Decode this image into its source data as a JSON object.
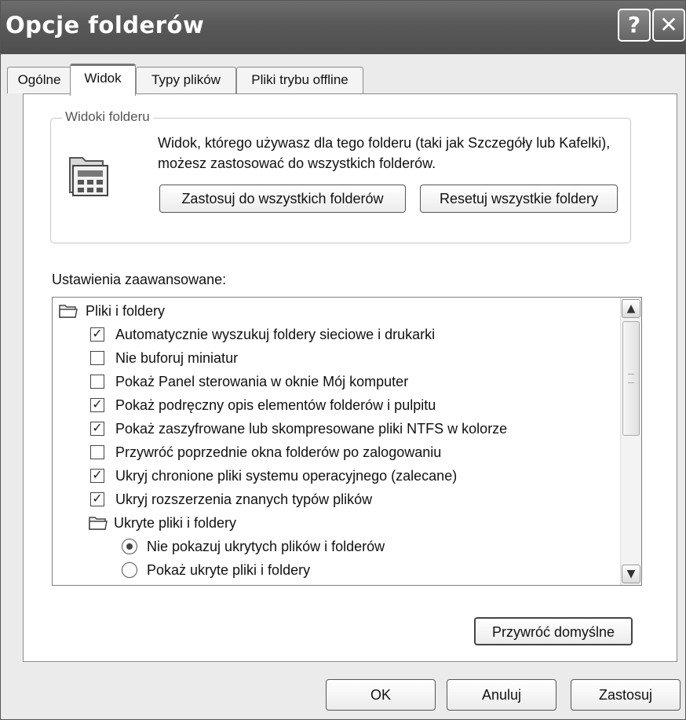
{
  "window": {
    "title": "Opcje folderów",
    "help_glyph": "?",
    "close_glyph": "✕"
  },
  "tabs": [
    {
      "label": "Ogólne"
    },
    {
      "label": "Widok",
      "active": true
    },
    {
      "label": "Typy plików"
    },
    {
      "label": "Pliki trybu offline"
    }
  ],
  "folder_views": {
    "legend": "Widoki folderu",
    "description": "Widok, którego używasz dla tego folderu (taki jak Szczegóły lub Kafelki), możesz zastosować do wszystkich folderów.",
    "apply_all_label": "Zastosuj do wszystkich folderów",
    "reset_all_label": "Resetuj wszystkie foldery"
  },
  "advanced": {
    "label": "Ustawienia zaawansowane:",
    "items": [
      {
        "type": "folder",
        "level": 0,
        "label": "Pliki i foldery"
      },
      {
        "type": "checkbox",
        "level": 1,
        "checked": true,
        "label": "Automatycznie wyszukuj foldery sieciowe i drukarki"
      },
      {
        "type": "checkbox",
        "level": 1,
        "checked": false,
        "label": "Nie buforuj miniatur"
      },
      {
        "type": "checkbox",
        "level": 1,
        "checked": false,
        "label": "Pokaż Panel sterowania w oknie Mój komputer"
      },
      {
        "type": "checkbox",
        "level": 1,
        "checked": true,
        "label": "Pokaż podręczny opis elementów folderów i pulpitu"
      },
      {
        "type": "checkbox",
        "level": 1,
        "checked": true,
        "label": "Pokaż zaszyfrowane lub skompresowane pliki NTFS w kolorze"
      },
      {
        "type": "checkbox",
        "level": 1,
        "checked": false,
        "label": "Przywróć poprzednie okna folderów po zalogowaniu"
      },
      {
        "type": "checkbox",
        "level": 1,
        "checked": true,
        "label": "Ukryj chronione pliki systemu operacyjnego (zalecane)"
      },
      {
        "type": "checkbox",
        "level": 1,
        "checked": true,
        "label": "Ukryj rozszerzenia znanych typów plików"
      },
      {
        "type": "folder",
        "level": 1,
        "label": "Ukryte pliki i foldery"
      },
      {
        "type": "radio",
        "level": 2,
        "checked": true,
        "label": "Nie pokazuj ukrytych plików i folderów"
      },
      {
        "type": "radio",
        "level": 2,
        "checked": false,
        "label": "Pokaż ukryte pliki i foldery"
      }
    ],
    "restore_defaults_label": "Przywróć domyślne"
  },
  "footer": {
    "ok_label": "OK",
    "cancel_label": "Anuluj",
    "apply_label": "Zastosuj"
  },
  "colors": {
    "titlebar": "#5a5a5a",
    "window_bg": "#ebebeb",
    "panel_bg": "#ffffff"
  }
}
